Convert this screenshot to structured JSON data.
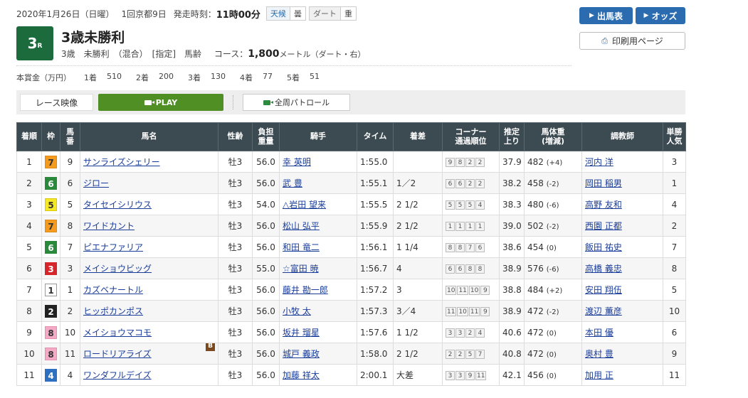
{
  "header": {
    "date": "2020年1月26日（日曜）",
    "meeting": "1回京都9日",
    "start_label": "発走時刻：",
    "start_time": "11時00分",
    "weather_label": "天候",
    "weather": "曇",
    "track_label": "ダート",
    "track_cond": "重"
  },
  "race": {
    "number": "3",
    "number_suffix": "R",
    "title": "3歳未勝利",
    "conditions": "3歳　未勝利　（混合）　[指定]　馬齢",
    "course_label": "コース：",
    "distance": "1,800",
    "distance_unit": "メートル（ダート・右）"
  },
  "prize": {
    "label": "本賞金（万円）",
    "items": [
      "1着",
      "510",
      "2着",
      "200",
      "3着",
      "130",
      "4着",
      "77",
      "5着",
      "51"
    ]
  },
  "buttons": {
    "entries": "出馬表",
    "odds": "オッズ",
    "print": "印刷用ページ"
  },
  "video": {
    "label": "レース映像",
    "play": "PLAY",
    "patrol": "全周パトロール"
  },
  "table": {
    "headers": [
      "着順",
      "枠",
      "馬番",
      "馬名",
      "性齢",
      "負担重量",
      "騎手",
      "タイム",
      "着差",
      "コーナー通過順位",
      "推定上り",
      "馬体重(増減)",
      "調教師",
      "単勝人気"
    ],
    "rows": [
      {
        "pos": "1",
        "waku": "7",
        "num": "9",
        "horse": "サンライズシェリー",
        "sex": "牡3",
        "wt": "56.0",
        "jockey": "幸 英明",
        "time": "1:55.0",
        "margin": "",
        "corner": [
          "9",
          "8",
          "2",
          "2"
        ],
        "agari": "37.9",
        "bw": "482",
        "bwd": "(+4)",
        "trainer": "河内 洋",
        "pop": "3"
      },
      {
        "pos": "2",
        "waku": "6",
        "num": "6",
        "horse": "ジロー",
        "sex": "牡3",
        "wt": "56.0",
        "jockey": "武 豊",
        "time": "1:55.1",
        "margin": "1／2",
        "corner": [
          "6",
          "6",
          "2",
          "2"
        ],
        "agari": "38.2",
        "bw": "458",
        "bwd": "(-2)",
        "trainer": "岡田 稲男",
        "pop": "1"
      },
      {
        "pos": "3",
        "waku": "5",
        "num": "5",
        "horse": "タイセイシリウス",
        "sex": "牡3",
        "wt": "54.0",
        "jockey": "△岩田 望来",
        "time": "1:55.5",
        "margin": "2 1/2",
        "corner": [
          "5",
          "5",
          "5",
          "4"
        ],
        "agari": "38.3",
        "bw": "480",
        "bwd": "(-6)",
        "trainer": "高野 友和",
        "pop": "4"
      },
      {
        "pos": "4",
        "waku": "7",
        "num": "8",
        "horse": "ワイドカント",
        "sex": "牡3",
        "wt": "56.0",
        "jockey": "松山 弘平",
        "time": "1:55.9",
        "margin": "2 1/2",
        "corner": [
          "1",
          "1",
          "1",
          "1"
        ],
        "agari": "39.0",
        "bw": "502",
        "bwd": "(-2)",
        "trainer": "西園 正都",
        "pop": "2"
      },
      {
        "pos": "5",
        "waku": "6",
        "num": "7",
        "horse": "ピエナファリア",
        "sex": "牡3",
        "wt": "56.0",
        "jockey": "和田 竜二",
        "time": "1:56.1",
        "margin": "1 1/4",
        "corner": [
          "8",
          "8",
          "7",
          "6"
        ],
        "agari": "38.6",
        "bw": "454",
        "bwd": "(0)",
        "trainer": "飯田 祐史",
        "pop": "7"
      },
      {
        "pos": "6",
        "waku": "3",
        "num": "3",
        "horse": "メイショウビッグ",
        "sex": "牡3",
        "wt": "55.0",
        "jockey": "☆富田 暁",
        "time": "1:56.7",
        "margin": "4",
        "corner": [
          "6",
          "6",
          "8",
          "8"
        ],
        "agari": "38.9",
        "bw": "576",
        "bwd": "(-6)",
        "trainer": "高橋 義忠",
        "pop": "8"
      },
      {
        "pos": "7",
        "waku": "1",
        "num": "1",
        "horse": "カズベナートル",
        "sex": "牡3",
        "wt": "56.0",
        "jockey": "藤井 勘一郎",
        "time": "1:57.2",
        "margin": "3",
        "corner": [
          "10",
          "11",
          "10",
          "9"
        ],
        "agari": "38.8",
        "bw": "484",
        "bwd": "(+2)",
        "trainer": "安田 翔伍",
        "pop": "5"
      },
      {
        "pos": "8",
        "waku": "2",
        "num": "2",
        "horse": "ヒッポカンポス",
        "sex": "牡3",
        "wt": "56.0",
        "jockey": "小牧 太",
        "time": "1:57.3",
        "margin": "3／4",
        "corner": [
          "11",
          "10",
          "11",
          "9"
        ],
        "agari": "38.9",
        "bw": "472",
        "bwd": "(-2)",
        "trainer": "渡辺 薫彦",
        "pop": "10"
      },
      {
        "pos": "9",
        "waku": "8",
        "num": "10",
        "horse": "メイショウマコモ",
        "sex": "牡3",
        "wt": "56.0",
        "jockey": "坂井 瑠星",
        "time": "1:57.6",
        "margin": "1 1/2",
        "corner": [
          "3",
          "3",
          "2",
          "4"
        ],
        "agari": "40.6",
        "bw": "472",
        "bwd": "(0)",
        "trainer": "本田 優",
        "pop": "6"
      },
      {
        "pos": "10",
        "waku": "8",
        "num": "11",
        "horse": "ロードリアライズ",
        "sex": "牡3",
        "wt": "56.0",
        "jockey": "城戸 義政",
        "time": "1:58.0",
        "margin": "2 1/2",
        "corner": [
          "2",
          "2",
          "5",
          "7"
        ],
        "agari": "40.8",
        "bw": "472",
        "bwd": "(0)",
        "trainer": "奥村 豊",
        "pop": "9",
        "blinker": "B"
      },
      {
        "pos": "11",
        "waku": "4",
        "num": "4",
        "horse": "ワンダフルデイズ",
        "sex": "牡3",
        "wt": "56.0",
        "jockey": "加藤 祥太",
        "time": "2:00.1",
        "margin": "大差",
        "corner": [
          "3",
          "3",
          "9",
          "11"
        ],
        "agari": "42.1",
        "bw": "456",
        "bwd": "(0)",
        "trainer": "加用 正",
        "pop": "11"
      }
    ]
  },
  "waku_colors": {
    "1": {
      "bg": "#ffffff",
      "fg": "#333333",
      "border": "#999999"
    },
    "2": {
      "bg": "#222222",
      "fg": "#ffffff",
      "border": "#222222"
    },
    "3": {
      "bg": "#d7262b",
      "fg": "#ffffff",
      "border": "#d7262b"
    },
    "4": {
      "bg": "#2d6fc0",
      "fg": "#ffffff",
      "border": "#2d6fc0"
    },
    "5": {
      "bg": "#f5e829",
      "fg": "#333333",
      "border": "#d8c800"
    },
    "6": {
      "bg": "#2a8a3c",
      "fg": "#ffffff",
      "border": "#2a8a3c"
    },
    "7": {
      "bg": "#f39a1f",
      "fg": "#333333",
      "border": "#e08a10"
    },
    "8": {
      "bg": "#f4a9c4",
      "fg": "#333333",
      "border": "#e58fb0"
    }
  }
}
